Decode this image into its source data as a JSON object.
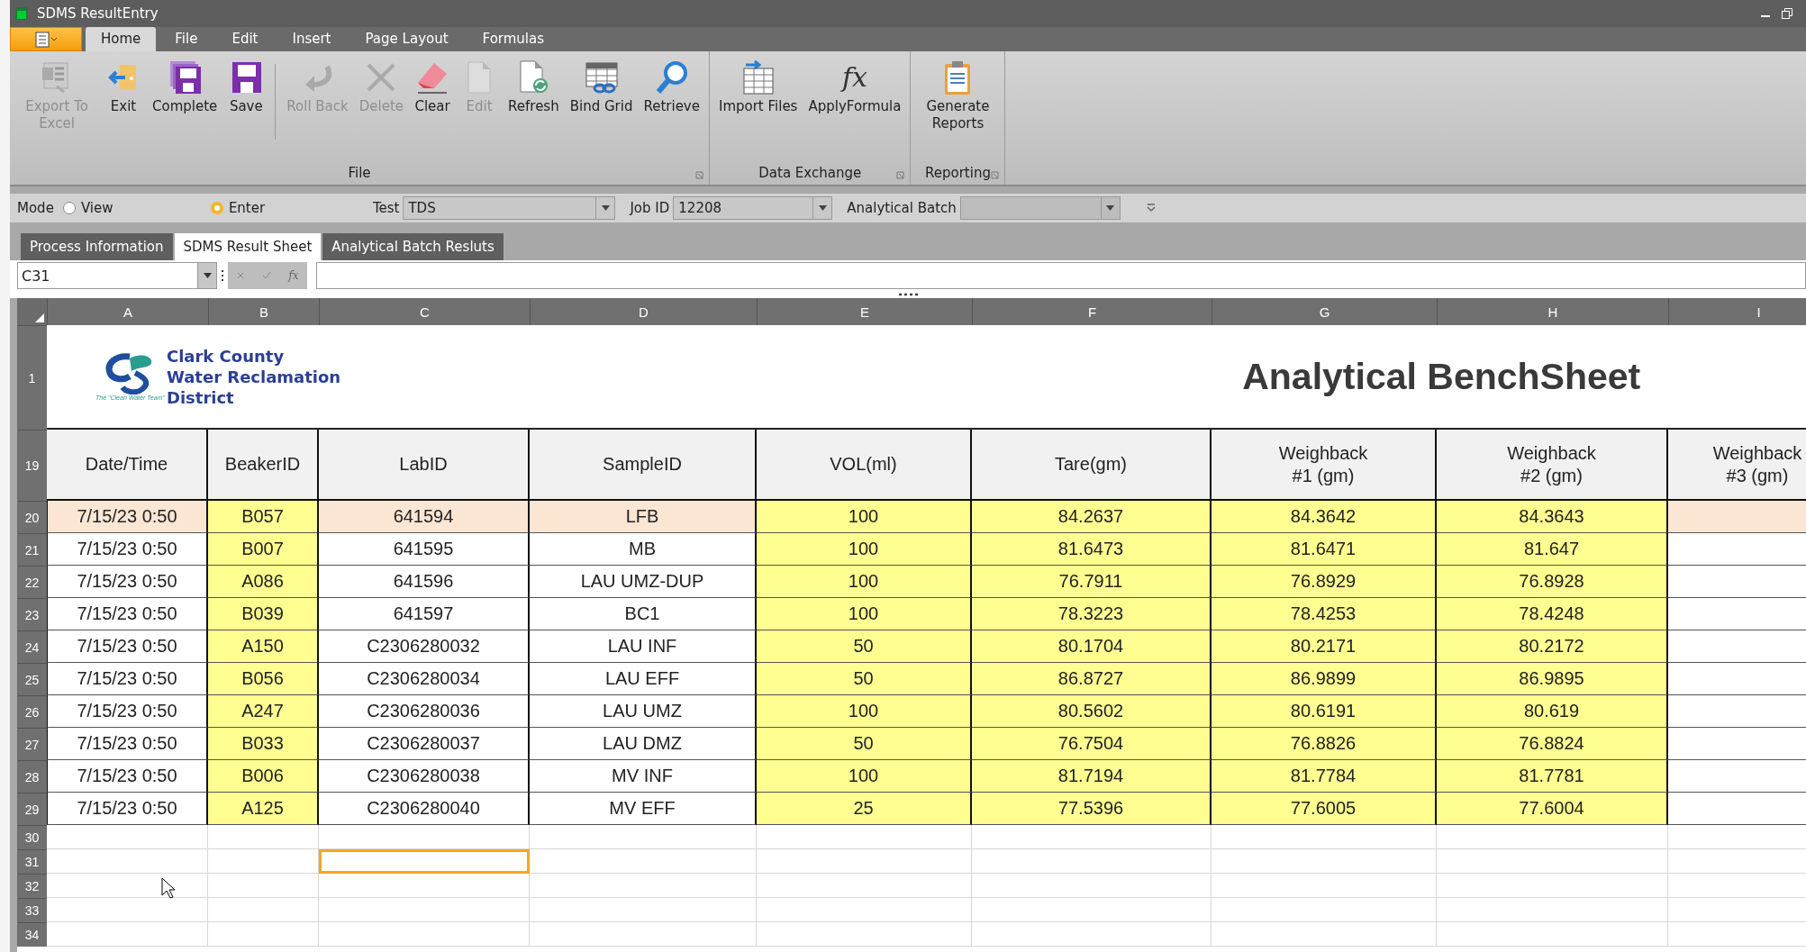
{
  "window": {
    "title": "SDMS ResultEntry"
  },
  "menu_tabs": [
    {
      "label": "Home",
      "selected": true
    },
    {
      "label": "File",
      "selected": false
    },
    {
      "label": "Edit",
      "selected": false
    },
    {
      "label": "Insert",
      "selected": false
    },
    {
      "label": "Page Layout",
      "selected": false
    },
    {
      "label": "Formulas",
      "selected": false
    }
  ],
  "ribbon": {
    "groups": [
      {
        "label": "File",
        "sections": [
          [
            {
              "label": "Export To Excel",
              "disabled": true
            },
            {
              "label": "Exit",
              "disabled": false
            },
            {
              "label": "Complete",
              "disabled": false
            },
            {
              "label": "Save",
              "disabled": false
            }
          ],
          [
            {
              "label": "Roll Back",
              "disabled": true
            },
            {
              "label": "Delete",
              "disabled": true
            },
            {
              "label": "Clear",
              "disabled": false
            },
            {
              "label": "Edit",
              "disabled": true
            },
            {
              "label": "Refresh",
              "disabled": false
            },
            {
              "label": "Bind Grid",
              "disabled": false
            },
            {
              "label": "Retrieve",
              "disabled": false
            }
          ]
        ]
      },
      {
        "label": "Data Exchange",
        "sections": [
          [
            {
              "label": "Import Files",
              "disabled": false
            },
            {
              "label": "ApplyFormula",
              "disabled": false,
              "icon_text": "fx"
            }
          ]
        ]
      },
      {
        "label": "Reporting",
        "sections": [
          [
            {
              "label": "Generate Reports",
              "disabled": false
            }
          ]
        ]
      }
    ]
  },
  "mode_bar": {
    "label": "Mode",
    "radios": [
      {
        "label": "View",
        "selected": false
      },
      {
        "label": "Enter",
        "selected": true
      }
    ],
    "test": {
      "label": "Test",
      "value": "TDS"
    },
    "job_id": {
      "label": "Job ID",
      "value": "12208"
    },
    "analytical_batch": {
      "label": "Analytical Batch"
    }
  },
  "sheet_tabs": [
    {
      "label": "Process Information",
      "selected": false
    },
    {
      "label": "SDMS Result Sheet",
      "selected": true
    },
    {
      "label": "Analytical Batch Resluts",
      "selected": false
    }
  ],
  "formula_bar": {
    "cell_ref": "C31",
    "function_symbol": "fx"
  },
  "sheet": {
    "columns": [
      "A",
      "B",
      "C",
      "D",
      "E",
      "F",
      "G",
      "H",
      "I"
    ],
    "logo": {
      "lines": [
        "Clark County",
        "Water Reclamation",
        "District"
      ],
      "tagline": "The \"Clean Water Team\""
    },
    "title_row": {
      "number": "1",
      "title": "Analytical BenchSheet"
    },
    "header_row": {
      "number": "19",
      "cells": [
        "Date/Time",
        "BeakerID",
        "LabID",
        "SampleID",
        "VOL(ml)",
        "Tare(gm)",
        "Weighback\n#1 (gm)",
        "Weighback\n#2 (gm)",
        "Weighback\n#3 (gm)"
      ]
    },
    "rows": [
      {
        "number": "20",
        "highlighted": true,
        "cells": [
          "7/15/23 0:50",
          "B057",
          "641594",
          "LFB",
          "100",
          "84.2637",
          "84.3642",
          "84.3643"
        ]
      },
      {
        "number": "21",
        "highlighted": false,
        "cells": [
          "7/15/23 0:50",
          "B007",
          "641595",
          "MB",
          "100",
          "81.6473",
          "81.6471",
          "81.647"
        ]
      },
      {
        "number": "22",
        "highlighted": false,
        "cells": [
          "7/15/23 0:50",
          "A086",
          "641596",
          "LAU UMZ-DUP",
          "100",
          "76.7911",
          "76.8929",
          "76.8928"
        ]
      },
      {
        "number": "23",
        "highlighted": false,
        "cells": [
          "7/15/23 0:50",
          "B039",
          "641597",
          "BC1",
          "100",
          "78.3223",
          "78.4253",
          "78.4248"
        ]
      },
      {
        "number": "24",
        "highlighted": false,
        "cells": [
          "7/15/23 0:50",
          "A150",
          "C2306280032",
          "LAU INF",
          "50",
          "80.1704",
          "80.2171",
          "80.2172"
        ]
      },
      {
        "number": "25",
        "highlighted": false,
        "cells": [
          "7/15/23 0:50",
          "B056",
          "C2306280034",
          "LAU EFF",
          "50",
          "86.8727",
          "86.9899",
          "86.9895"
        ]
      },
      {
        "number": "26",
        "highlighted": false,
        "cells": [
          "7/15/23 0:50",
          "A247",
          "C2306280036",
          "LAU UMZ",
          "100",
          "80.5602",
          "80.6191",
          "80.619"
        ]
      },
      {
        "number": "27",
        "highlighted": false,
        "cells": [
          "7/15/23 0:50",
          "B033",
          "C2306280037",
          "LAU DMZ",
          "50",
          "76.7504",
          "76.8826",
          "76.8824"
        ]
      },
      {
        "number": "28",
        "highlighted": false,
        "cells": [
          "7/15/23 0:50",
          "B006",
          "C2306280038",
          "MV INF",
          "100",
          "81.7194",
          "81.7784",
          "81.7781"
        ]
      },
      {
        "number": "29",
        "highlighted": false,
        "cells": [
          "7/15/23 0:50",
          "A125",
          "C2306280040",
          "MV EFF",
          "25",
          "77.5396",
          "77.6005",
          "77.6004"
        ]
      }
    ],
    "empty_rows": [
      {
        "number": "30",
        "cells": [
          {
            "selected": false
          },
          {
            "selected": false
          },
          {
            "selected": false
          },
          {
            "selected": false
          },
          {
            "selected": false
          },
          {
            "selected": false
          },
          {
            "selected": false
          },
          {
            "selected": false
          },
          {
            "selected": false
          }
        ]
      },
      {
        "number": "31",
        "cells": [
          {
            "selected": false
          },
          {
            "selected": false
          },
          {
            "selected": true
          },
          {
            "selected": false
          },
          {
            "selected": false
          },
          {
            "selected": false
          },
          {
            "selected": false
          },
          {
            "selected": false
          },
          {
            "selected": false
          }
        ]
      },
      {
        "number": "32",
        "cells": [
          {
            "selected": false
          },
          {
            "selected": false
          },
          {
            "selected": false
          },
          {
            "selected": false
          },
          {
            "selected": false
          },
          {
            "selected": false
          },
          {
            "selected": false
          },
          {
            "selected": false
          },
          {
            "selected": false
          }
        ]
      },
      {
        "number": "33",
        "cells": [
          {
            "selected": false
          },
          {
            "selected": false
          },
          {
            "selected": false
          },
          {
            "selected": false
          },
          {
            "selected": false
          },
          {
            "selected": false
          },
          {
            "selected": false
          },
          {
            "selected": false
          },
          {
            "selected": false
          }
        ]
      },
      {
        "number": "34",
        "cells": [
          {
            "selected": false
          },
          {
            "selected": false
          },
          {
            "selected": false
          },
          {
            "selected": false
          },
          {
            "selected": false
          },
          {
            "selected": false
          },
          {
            "selected": false
          },
          {
            "selected": false
          },
          {
            "selected": false
          }
        ]
      }
    ]
  }
}
